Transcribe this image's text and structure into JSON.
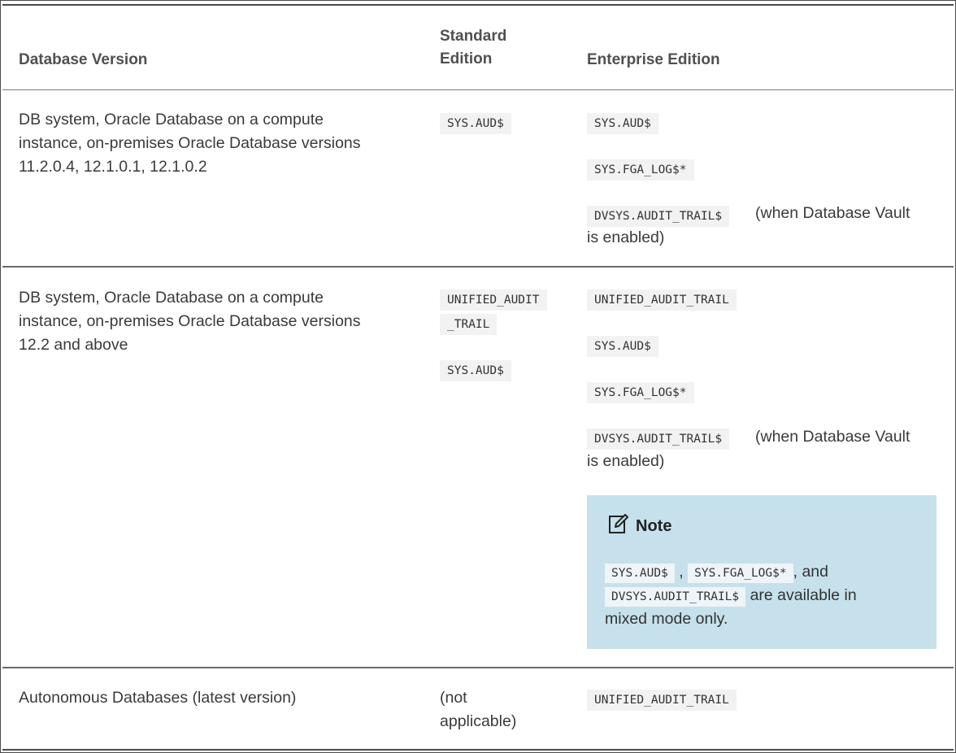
{
  "table": {
    "headers": {
      "version": "Database Version",
      "standard_line1": "Standard",
      "standard_line2": "Edition",
      "enterprise": "Enterprise Edition"
    },
    "rows": [
      {
        "version_lines": [
          "DB system, Oracle Database on a compute",
          "instance, on-premises Oracle Database versions",
          "11.2.0.4, 12.1.0.1, 12.1.0.2"
        ],
        "standard": [
          "SYS.AUD$"
        ],
        "enterprise": [
          "SYS.AUD$",
          "SYS.FGA_LOG$*",
          "DVSYS.AUDIT_TRAIL$"
        ],
        "enterprise_suffix": "(when Database Vault",
        "enterprise_suffix2": "is enabled)"
      },
      {
        "version_lines": [
          "DB system, Oracle Database on a compute",
          "instance, on-premises Oracle Database versions",
          "12.2 and above"
        ],
        "standard": [
          "UNIFIED_AUDIT",
          "_TRAIL",
          "SYS.AUD$"
        ],
        "enterprise": [
          "UNIFIED_AUDIT_TRAIL",
          "SYS.AUD$",
          "SYS.FGA_LOG$*",
          "DVSYS.AUDIT_TRAIL$"
        ],
        "enterprise_suffix": "(when Database Vault",
        "enterprise_suffix2": "is enabled)",
        "note": {
          "title": "Note",
          "code1": "SYS.AUD$",
          "sep1": ",",
          "code2": "SYS.FGA_LOG$*",
          "sep2": ", and",
          "code3": "DVSYS.AUDIT_TRAIL$",
          "text1": "are available in",
          "text2": "mixed mode only."
        }
      },
      {
        "version_lines": [
          "Autonomous Databases (latest version)"
        ],
        "standard_lines": [
          "(not",
          "applicable)"
        ],
        "enterprise": [
          "UNIFIED_AUDIT_TRAIL"
        ]
      }
    ]
  }
}
